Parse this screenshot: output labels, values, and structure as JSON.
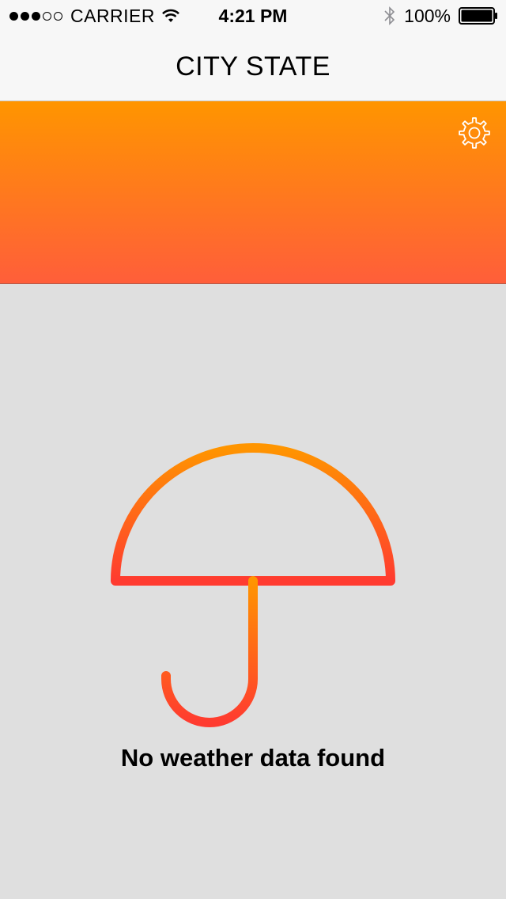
{
  "status_bar": {
    "carrier": "CARRIER",
    "time": "4:21 PM",
    "battery_percent": "100%",
    "signal_bars_filled": 3,
    "signal_bars_total": 5,
    "icons": [
      "wifi-icon",
      "bluetooth-icon",
      "battery-icon"
    ]
  },
  "nav": {
    "title": "CITY STATE"
  },
  "header": {
    "gradient_top": "#ff9500",
    "gradient_bottom": "#ff5e3a",
    "settings_icon": "gear-icon"
  },
  "empty_state": {
    "icon": "umbrella-icon",
    "message": "No weather data found",
    "icon_color_top": "#ff9500",
    "icon_color_bottom": "#ff3b30"
  },
  "colors": {
    "background": "#dfdfdf",
    "bar_background": "#f7f7f7"
  }
}
